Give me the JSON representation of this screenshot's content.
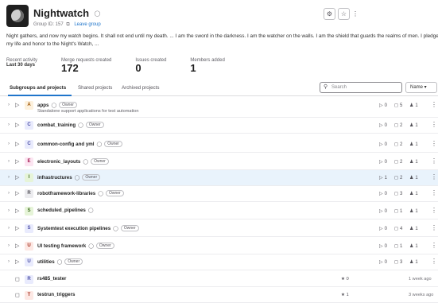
{
  "group": {
    "name": "Nightwatch",
    "group_id": "Group ID: 157",
    "leave_label": "Leave group",
    "description": "Night gathers, and now my watch begins. It shall not end until my death. ... I am the sword in the darkness. I am the watcher on the walls. I am the shield that guards the realms of men. I pledge my life and honor to the Night's Watch, ..."
  },
  "stats": {
    "recent_label": "Recent activity",
    "recent_period": "Last 30 days",
    "items": [
      {
        "label": "Merge requests created",
        "value": "172"
      },
      {
        "label": "Issues created",
        "value": "0"
      },
      {
        "label": "Members added",
        "value": "1"
      }
    ]
  },
  "tabs": {
    "subgroups": "Subgroups and projects",
    "shared": "Shared projects",
    "archived": "Archived projects"
  },
  "search": {
    "placeholder": "Search"
  },
  "sort": {
    "label": "Name"
  },
  "rows": [
    {
      "letter": "A",
      "name": "apps",
      "role": "Owner",
      "desc": "Standalone support applications for test automation",
      "subgroups": "0",
      "projects": "5",
      "members": "1",
      "color": "#fdf1dd",
      "fg": "#9e5400"
    },
    {
      "letter": "C",
      "name": "combat_training",
      "role": "Owner",
      "subgroups": "0",
      "projects": "2",
      "members": "1",
      "color": "#e9ebfd",
      "fg": "#4b4fa6"
    },
    {
      "letter": "C",
      "name": "common-config and yml",
      "role": "Owner",
      "subgroups": "0",
      "projects": "2",
      "members": "1",
      "color": "#e9ebfd",
      "fg": "#4b4fa6"
    },
    {
      "letter": "E",
      "name": "electronic_layouts",
      "role": "Owner",
      "subgroups": "0",
      "projects": "2",
      "members": "1",
      "color": "#fce5f1",
      "fg": "#a3154f"
    },
    {
      "letter": "I",
      "name": "infrastructures",
      "role": "Owner",
      "subgroups": "1",
      "projects": "2",
      "members": "1",
      "color": "#e6f4d8",
      "fg": "#3d6b1e"
    },
    {
      "letter": "R",
      "name": "robotframework-libraries",
      "role": "Owner",
      "subgroups": "0",
      "projects": "3",
      "members": "1",
      "color": "#ececef",
      "fg": "#535158"
    },
    {
      "letter": "S",
      "name": "scheduled_pipelines",
      "role": "",
      "subgroups": "0",
      "projects": "1",
      "members": "1",
      "color": "#e6f4d8",
      "fg": "#3d6b1e"
    },
    {
      "letter": "S",
      "name": "Systemtest execution pipelines",
      "role": "Owner",
      "subgroups": "0",
      "projects": "4",
      "members": "1",
      "color": "#e9ebfd",
      "fg": "#4b4fa6"
    },
    {
      "letter": "U",
      "name": "UI testing framework",
      "role": "Owner",
      "subgroups": "0",
      "projects": "1",
      "members": "1",
      "color": "#fde8e4",
      "fg": "#a32c1b"
    },
    {
      "letter": "U",
      "name": "utilities",
      "role": "Owner",
      "subgroups": "0",
      "projects": "3",
      "members": "1",
      "color": "#e9ebfd",
      "fg": "#4b4fa6"
    }
  ],
  "projects": [
    {
      "letter": "R",
      "name": "rs485_tester",
      "stars": "0",
      "updated": "1 week ago",
      "color": "#e9ebfd",
      "fg": "#4b4fa6"
    },
    {
      "letter": "T",
      "name": "testrun_triggers",
      "stars": "1",
      "updated": "3 weeks ago",
      "color": "#fde8e4",
      "fg": "#a32c1b"
    }
  ],
  "icons": {
    "visibility": "lock-icon",
    "copy": "copy-icon",
    "notifications": "bell-icon",
    "star": "star-icon",
    "search": "search-icon",
    "subgroup": "subgroup-icon",
    "project": "project-icon",
    "members": "users-icon"
  }
}
